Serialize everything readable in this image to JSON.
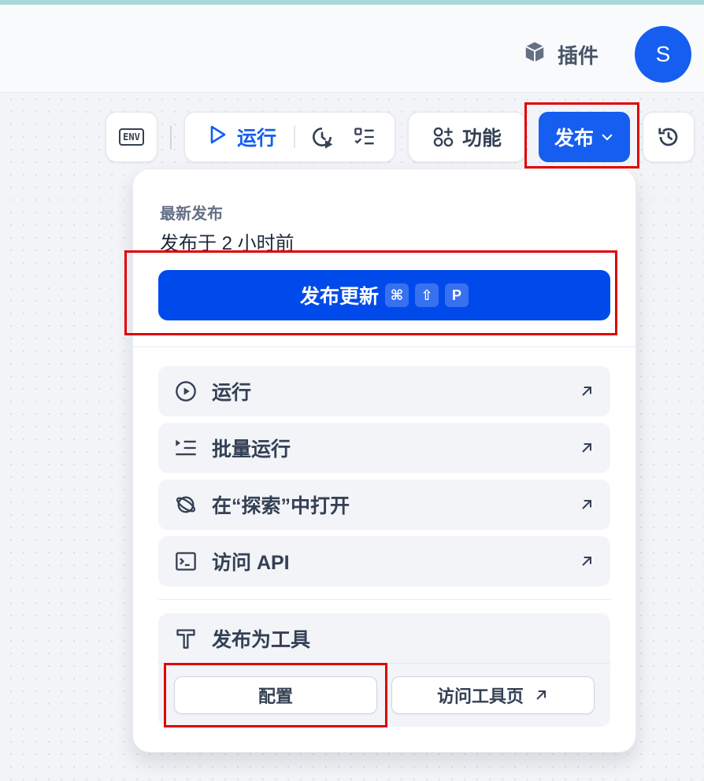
{
  "header": {
    "plugin_label": "插件",
    "avatar_initial": "S"
  },
  "toolbar": {
    "env_label": "ENV",
    "run_label": "运行",
    "feature_label": "功能",
    "publish_label": "发布"
  },
  "dropdown": {
    "latest_label": "最新发布",
    "published_time": "发布于 2 小时前",
    "update_button": {
      "label": "发布更新",
      "shortcut": [
        "⌘",
        "⇧",
        "P"
      ]
    },
    "menu_items": [
      {
        "label": "运行",
        "icon": "play-circle-icon"
      },
      {
        "label": "批量运行",
        "icon": "batch-run-icon"
      },
      {
        "label": "在“探索”中打开",
        "icon": "planet-icon"
      },
      {
        "label": "访问 API",
        "icon": "terminal-icon"
      }
    ],
    "tool_section": {
      "title": "发布为工具",
      "configure_label": "配置",
      "visit_tool_page_label": "访问工具页"
    }
  },
  "colors": {
    "primary": "#155eef",
    "update_button": "#004aeb",
    "highlight_box": "#e00000"
  }
}
